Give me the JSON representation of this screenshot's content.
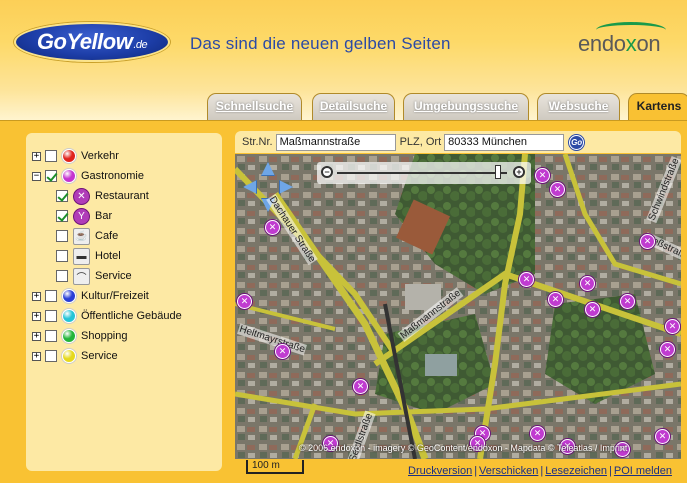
{
  "header": {
    "logo": "GoYellow",
    "logo_suffix": ".de",
    "tagline": "Das sind die neuen gelben Seiten",
    "brand_main": "endo",
    "brand_x": "x",
    "brand_end": "on"
  },
  "tabs": [
    {
      "label": "Schnellsuche"
    },
    {
      "label": "Detailsuche"
    },
    {
      "label": "Umgebungssuche"
    },
    {
      "label": "Websuche"
    },
    {
      "label": "Kartens"
    }
  ],
  "layers": [
    {
      "label": "Verkehr",
      "expander": "+",
      "checked": false,
      "color": "#e0231c"
    },
    {
      "label": "Gastronomie",
      "expander": "−",
      "checked": true,
      "color": "#c534d0"
    },
    {
      "label": "Restaurant",
      "checked": true,
      "icon": "restaurant-icon",
      "glyph": "✕"
    },
    {
      "label": "Bar",
      "checked": true,
      "icon": "cocktail-icon",
      "glyph": "Y"
    },
    {
      "label": "Cafe",
      "checked": false,
      "icon": "coffee-cup-icon",
      "glyph": "☕"
    },
    {
      "label": "Hotel",
      "checked": false,
      "icon": "bed-icon",
      "glyph": "▬"
    },
    {
      "label": "Service",
      "checked": false,
      "icon": "service-bell-icon",
      "glyph": "⌒"
    },
    {
      "label": "Kultur/Freizeit",
      "expander": "+",
      "checked": false,
      "color": "#2a3fd6"
    },
    {
      "label": "Öffentliche Gebäude",
      "expander": "+",
      "checked": false,
      "color": "#24c4d6"
    },
    {
      "label": "Shopping",
      "expander": "+",
      "checked": false,
      "color": "#23b53a"
    },
    {
      "label": "Service",
      "expander": "+",
      "checked": false,
      "color": "#e5d81c"
    }
  ],
  "search": {
    "street_label": "Str.Nr.",
    "street_value": "Maßmannstraße",
    "city_label": "PLZ, Ort",
    "city_value": "80333 München",
    "go_label": "Go"
  },
  "map": {
    "street_labels": [
      "Maßmannstraße",
      "Dachauer Straße",
      "Schwindstraße",
      "Heßstraße",
      "Seidlstraße",
      "Heltmayrstraße"
    ],
    "poi_glyph": "✕",
    "copyright": "© 2006 endoxon - imagery © GeoContent/endoxon - Mapdata © Teleatlas / Imprint"
  },
  "scale": {
    "label": "100 m"
  },
  "links": [
    "Druckversion",
    "Verschicken",
    "Lesezeichen",
    "POI melden"
  ],
  "colors": {
    "accent": "#f9c233",
    "panel": "#fde9a4",
    "link": "#1d2f80",
    "poi": "#c03bd0"
  }
}
